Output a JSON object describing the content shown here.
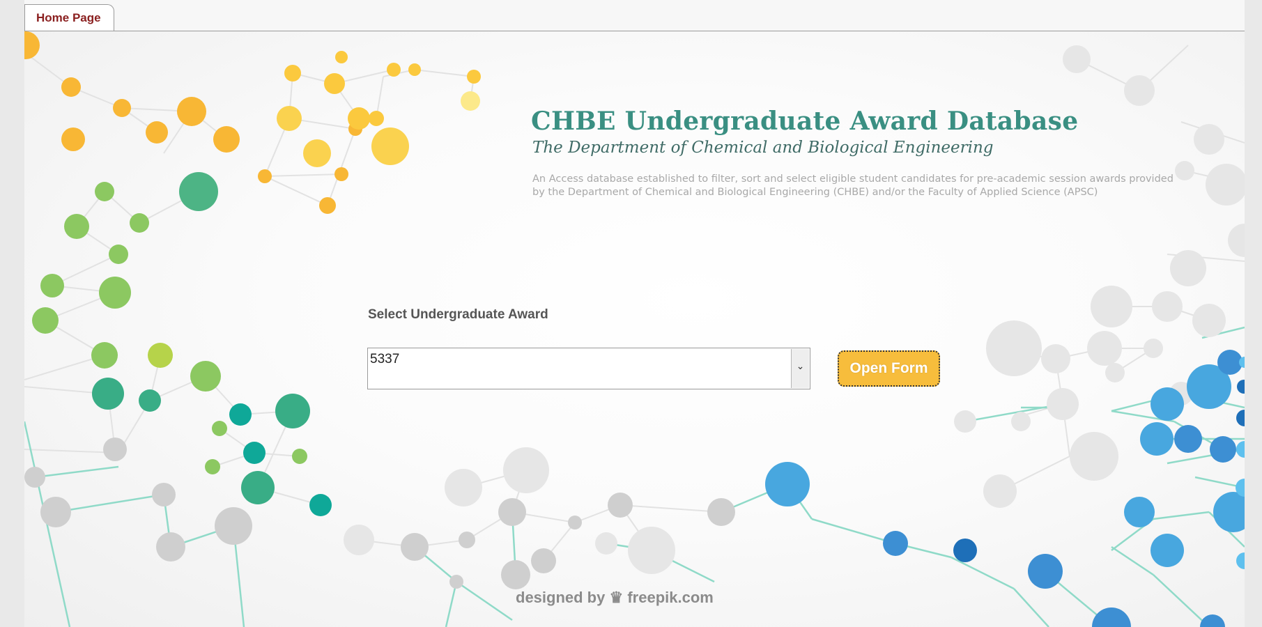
{
  "window": {
    "tab_label": "Home Page"
  },
  "header": {
    "title": "CHBE Undergraduate Award Database",
    "subtitle": "The Department of Chemical and Biological Engineering",
    "description": "An Access database established to filter, sort and select eligible student candidates for pre-academic session awards provided by the Department of Chemical and Biological Engineering (CHBE) and/or the Faculty of Applied Science (APSC)"
  },
  "form": {
    "select_label": "Select Undergraduate Award",
    "selected_award": "5337",
    "open_button_label": "Open Form"
  },
  "footer": {
    "credit_prefix": "designed by",
    "credit_brand": "freepik.com"
  },
  "colors": {
    "title": "#3a8f82",
    "button": "#f7bd3c",
    "tab_text": "#8a1f1f"
  },
  "icons": {
    "combo_dropdown": "chevron-down-icon",
    "credit_logo": "crown-icon"
  }
}
